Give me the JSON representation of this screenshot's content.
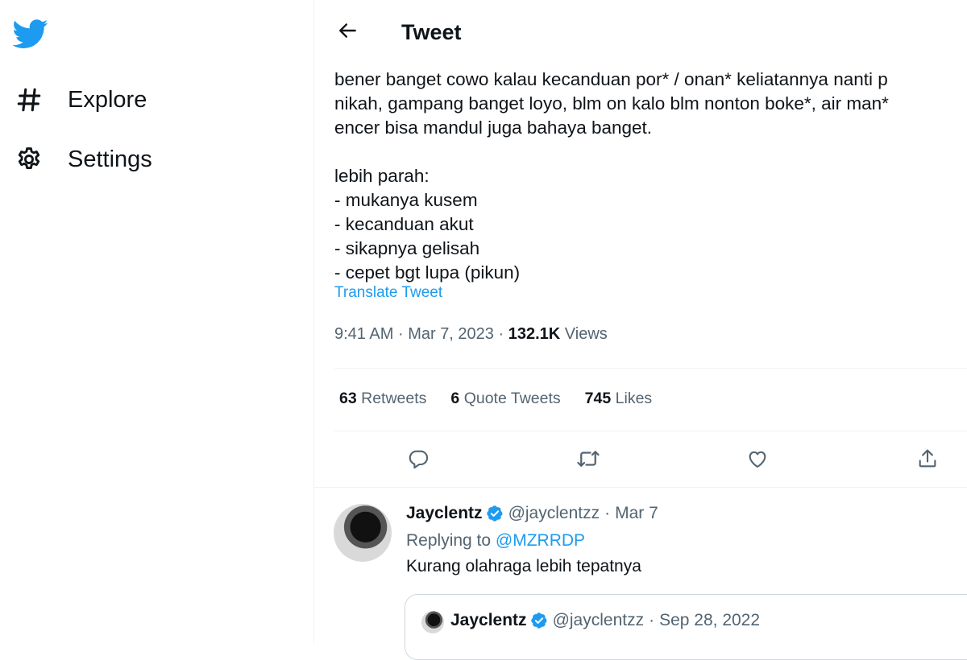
{
  "sidebar": {
    "logo_icon": "twitter-bird-icon",
    "items": [
      {
        "label": "Explore",
        "icon": "hashtag-icon"
      },
      {
        "label": "Settings",
        "icon": "gear-icon"
      }
    ]
  },
  "header": {
    "title": "Tweet",
    "back_icon": "arrow-left-icon"
  },
  "tweet": {
    "text": "bener banget cowo kalau kecanduan por* / onan* keliatannya nanti p\nnikah, gampang banget loyo, blm on kalo blm nonton boke*, air man*\nencer bisa mandul juga bahaya banget.\n\nlebih parah:\n- mukanya kusem\n- kecanduan akut\n- sikapnya gelisah\n- cepet bgt lupa (pikun)",
    "translate_label": "Translate Tweet",
    "time": "9:41 AM",
    "separator": "·",
    "date": "Mar 7, 2023",
    "separator2": "·",
    "views_count": "132.1K",
    "views_label": "Views",
    "retweets_count": "63",
    "retweets_label": "Retweets",
    "quotes_count": "6",
    "quotes_label": "Quote Tweets",
    "likes_count": "745",
    "likes_label": "Likes"
  },
  "actions": {
    "reply_icon": "reply-icon",
    "retweet_icon": "retweet-icon",
    "like_icon": "heart-icon",
    "share_icon": "share-icon"
  },
  "reply": {
    "name": "Jayclentz",
    "handle": "@jayclentzz",
    "dot": "·",
    "date": "Mar 7",
    "replying_prefix": "Replying to",
    "replying_to": "@MZRRDP",
    "text": "Kurang olahraga lebih tepatnya",
    "quote": {
      "name": "Jayclentz",
      "handle": "@jayclentzz",
      "dot": "·",
      "date": "Sep 28, 2022"
    }
  },
  "colors": {
    "accent": "#1d9bf0",
    "text": "#0f1419",
    "muted": "#536471",
    "border": "#eff3f4"
  }
}
